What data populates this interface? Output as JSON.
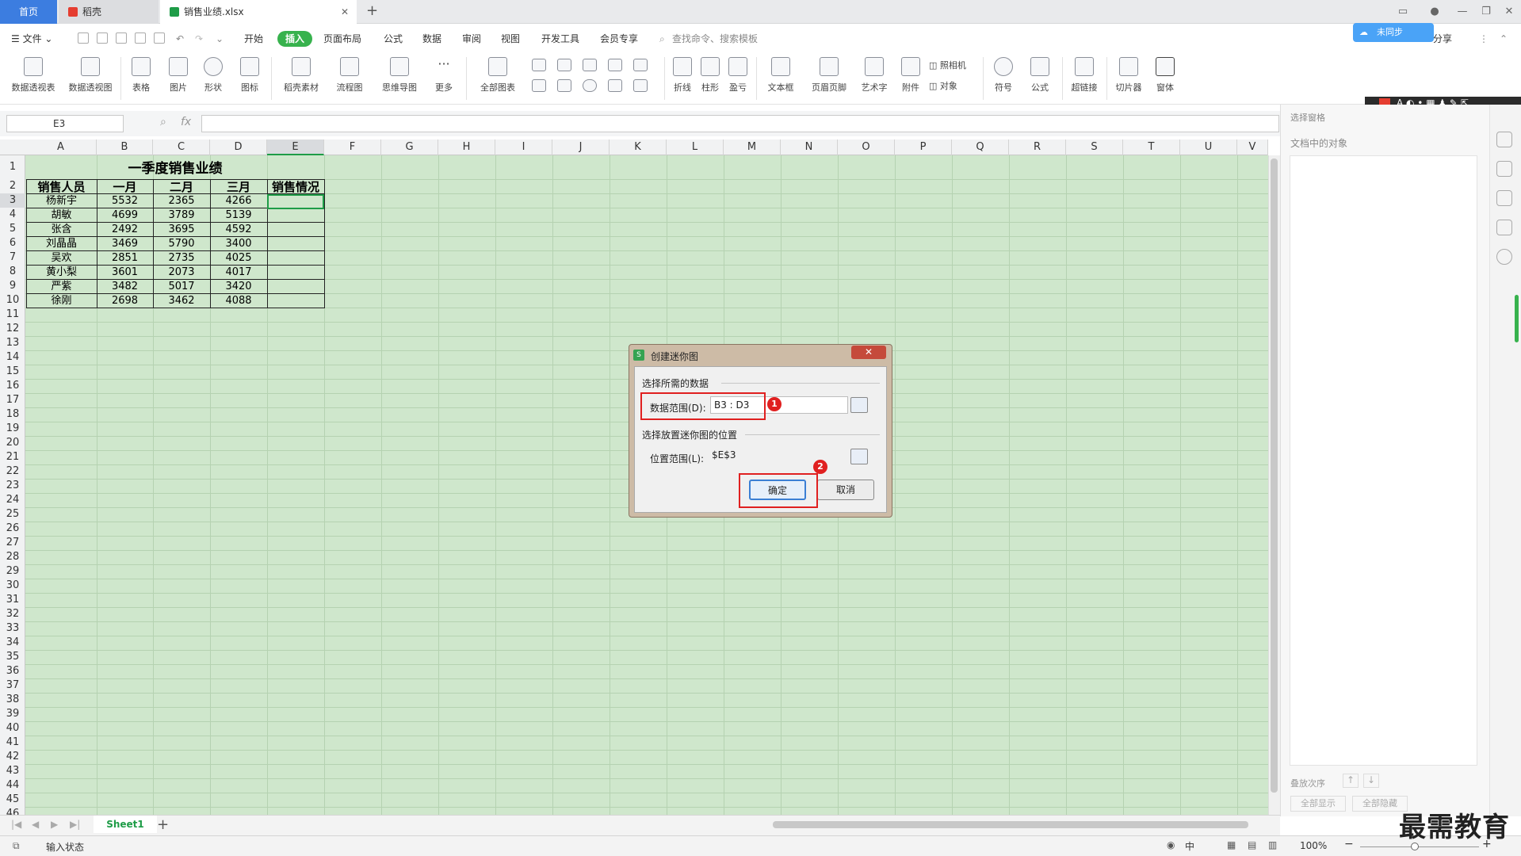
{
  "tabs": {
    "home": "首页",
    "dk": "稻壳",
    "doc": "销售业绩.xlsx",
    "new_tab": "+"
  },
  "menu": {
    "file": "文件",
    "items": [
      "开始",
      "插入",
      "页面布局",
      "公式",
      "数据",
      "审阅",
      "视图",
      "开发工具",
      "会员专享"
    ],
    "search_placeholder": "查找命令、搜索模板",
    "share": "分享",
    "sync": "未同步"
  },
  "ribbon": {
    "items": [
      "数据透视表",
      "数据透视图",
      "表格",
      "图片",
      "形状",
      "图标",
      "稻壳素材",
      "流程图",
      "思维导图",
      "更多",
      "全部图表",
      "折线",
      "柱形",
      "盈亏",
      "文本框",
      "页眉页脚",
      "艺术字",
      "附件",
      "照相机",
      "对象",
      "符号",
      "公式",
      "超链接",
      "切片器",
      "窗体"
    ]
  },
  "formula_bar": {
    "name_box": "E3",
    "fx": "fx",
    "value": ""
  },
  "sheet": {
    "columns": [
      "A",
      "B",
      "C",
      "D",
      "E",
      "F",
      "G",
      "H",
      "I",
      "J",
      "K",
      "L",
      "M",
      "N",
      "O",
      "P",
      "Q",
      "R",
      "S",
      "T",
      "U",
      "V"
    ],
    "title": "一季度销售业绩",
    "headers": [
      "销售人员",
      "一月",
      "二月",
      "三月",
      "销售情况"
    ],
    "rows": [
      [
        "杨新宇",
        "5532",
        "2365",
        "4266"
      ],
      [
        "胡敏",
        "4699",
        "3789",
        "5139"
      ],
      [
        "张含",
        "2492",
        "3695",
        "4592"
      ],
      [
        "刘晶晶",
        "3469",
        "5790",
        "3400"
      ],
      [
        "吴欢",
        "2851",
        "2735",
        "4025"
      ],
      [
        "黄小梨",
        "3601",
        "2073",
        "4017"
      ],
      [
        "严紫",
        "3482",
        "5017",
        "3420"
      ],
      [
        "徐刚",
        "2698",
        "3462",
        "4088"
      ]
    ],
    "row_count": 46
  },
  "dialog": {
    "title": "创建迷你图",
    "group1": "选择所需的数据",
    "data_range_label": "数据范围(D):",
    "data_range_value": "B3 : D3",
    "group2": "选择放置迷你图的位置",
    "location_label": "位置范围(L):",
    "location_value": "$E$3",
    "ok": "确定",
    "cancel": "取消",
    "badge1": "1",
    "badge2": "2"
  },
  "right_pane": {
    "title": "选择窗格",
    "subtitle": "文档中的对象",
    "order_label": "叠放次序",
    "show_all": "全部显示",
    "hide_all": "全部隐藏"
  },
  "bottom": {
    "sheet_tab": "Sheet1",
    "status": "输入状态",
    "zoom": "100%",
    "input_lang": "中"
  },
  "watermark": "最需教育",
  "colors": {
    "accent": "#37b24d",
    "tab_active": "#3c7de0",
    "grid_bg": "#cfe7cc",
    "highlight": "#e02020"
  }
}
